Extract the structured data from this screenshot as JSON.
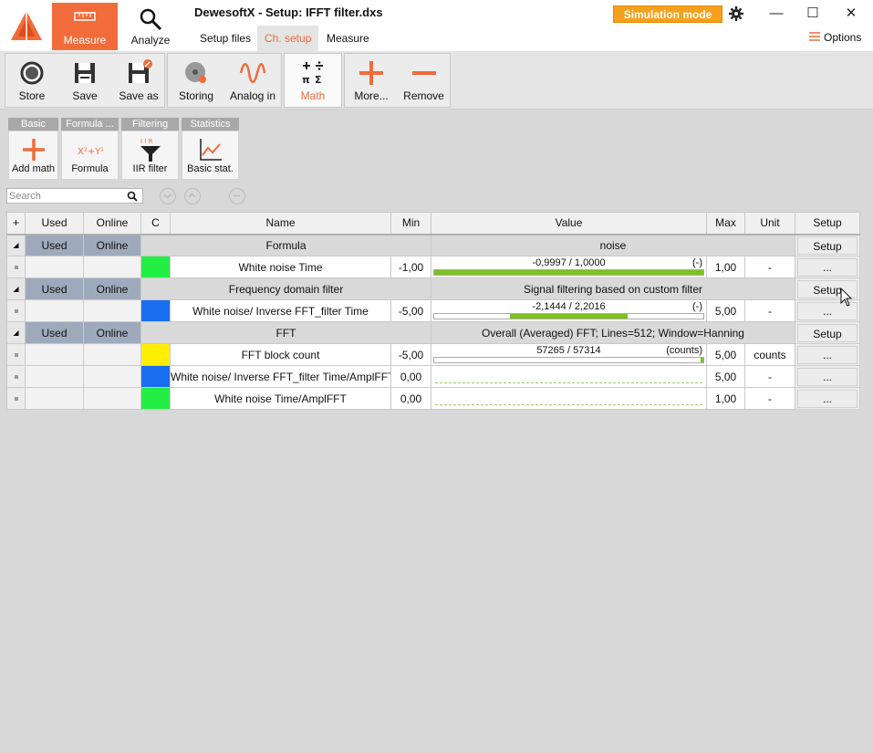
{
  "app": {
    "title": "DewesoftX - Setup: IFFT filter.dxs",
    "modes": [
      {
        "label": "Measure",
        "active": true
      },
      {
        "label": "Analyze",
        "active": false
      }
    ],
    "subtabs": [
      {
        "label": "Setup files",
        "active": false
      },
      {
        "label": "Ch. setup",
        "active": true
      },
      {
        "label": "Measure",
        "active": false
      }
    ],
    "simulation_mode": "Simulation mode",
    "options_label": "Options",
    "window_controls": [
      "minimize",
      "maximize",
      "close"
    ]
  },
  "toolbar": {
    "items": [
      {
        "label": "Store",
        "icon": "record-icon"
      },
      {
        "label": "Save",
        "icon": "floppy-icon"
      },
      {
        "label": "Save as",
        "icon": "floppy-edit-icon"
      },
      {
        "label": "Storing",
        "icon": "disk-storing-icon"
      },
      {
        "label": "Analog in",
        "icon": "sine-wave-icon"
      },
      {
        "label": "Math",
        "icon": "math-operators-icon",
        "active": true
      },
      {
        "label": "More...",
        "icon": "plus-icon"
      },
      {
        "label": "Remove",
        "icon": "minus-icon"
      }
    ]
  },
  "math_palette": {
    "groups": [
      {
        "header": "Basic",
        "button": "Add math",
        "icon": "plus-icon"
      },
      {
        "header": "Formula ...",
        "button": "Formula",
        "icon": "formula-icon"
      },
      {
        "header": "Filtering",
        "button": "IIR filter",
        "icon": "iir-filter-icon"
      },
      {
        "header": "Statistics",
        "button": "Basic stat.",
        "icon": "stats-chart-icon"
      }
    ]
  },
  "search": {
    "placeholder": "Search"
  },
  "table": {
    "headers": [
      "+",
      "Used",
      "Online",
      "C",
      "Name",
      "Min",
      "Value",
      "Max",
      "Unit",
      "Setup"
    ],
    "groups": [
      {
        "used": "Used",
        "online": "Online",
        "name": "Formula",
        "value": "noise",
        "setup": "Setup",
        "channels": [
          {
            "color": "#22ee44",
            "name": "White noise Time",
            "min": "-1,00",
            "value": "-0,9997 / 1,0000",
            "unit_tag": "(-)",
            "bar_fraction": 1.0,
            "bar_style": "full",
            "max": "1,00",
            "unit": "-",
            "setup": "..."
          }
        ]
      },
      {
        "used": "Used",
        "online": "Online",
        "name": "Frequency domain filter",
        "value": "Signal filtering based on custom filter",
        "setup": "Setup",
        "channels": [
          {
            "color": "#1a6ef0",
            "name": "White noise/ Inverse FFT_filter Time",
            "min": "-5,00",
            "value": "-2,1444 / 2,2016",
            "unit_tag": "(-)",
            "bar_from": 0.28,
            "bar_to": 0.72,
            "bar_style": "range",
            "max": "5,00",
            "unit": "-",
            "setup": "..."
          }
        ]
      },
      {
        "used": "Used",
        "online": "Online",
        "name": "FFT",
        "value": "Overall (Averaged) FFT; Lines=512; Window=Hanning",
        "setup": "Setup",
        "channels": [
          {
            "color": "#ffee00",
            "name": "FFT block count",
            "min": "-5,00",
            "value": "57265 / 57314",
            "unit_tag": "(counts)",
            "bar_from": 0.99,
            "bar_to": 1.0,
            "bar_style": "range",
            "max": "5,00",
            "unit": "counts",
            "setup": "..."
          },
          {
            "color": "#1a6ef0",
            "name": "White noise/ Inverse FFT_filter Time/AmplFFT",
            "min": "0,00",
            "value": "",
            "unit_tag": "",
            "bar_style": "dashed",
            "max": "5,00",
            "unit": "-",
            "setup": "..."
          },
          {
            "color": "#22ee44",
            "name": "White noise Time/AmplFFT",
            "min": "0,00",
            "value": "",
            "unit_tag": "",
            "bar_style": "dashed",
            "max": "1,00",
            "unit": "-",
            "setup": "..."
          }
        ]
      }
    ]
  }
}
